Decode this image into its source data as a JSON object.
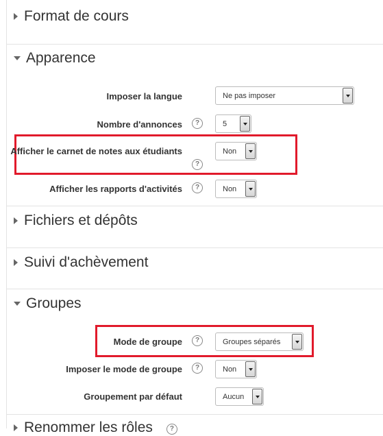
{
  "sections": [
    {
      "title": "Format de cours",
      "expanded": false
    },
    {
      "title": "Apparence",
      "expanded": true
    },
    {
      "title": "Fichiers et dépôts",
      "expanded": false
    },
    {
      "title": "Suivi d'achèvement",
      "expanded": false
    },
    {
      "title": "Groupes",
      "expanded": true
    },
    {
      "title": "Renommer les rôles",
      "expanded": false
    }
  ],
  "apparence": {
    "langue": {
      "label": "Imposer la langue",
      "value": "Ne pas imposer"
    },
    "annonces": {
      "label": "Nombre d'annonces",
      "value": "5"
    },
    "carnet": {
      "label": "Afficher le carnet de notes aux étudiants",
      "value": "Non"
    },
    "rapports": {
      "label": "Afficher les rapports d'activités",
      "value": "Non"
    }
  },
  "groupes": {
    "mode": {
      "label": "Mode de groupe",
      "value": "Groupes séparés"
    },
    "imposer": {
      "label": "Imposer le mode de groupe",
      "value": "Non"
    },
    "groupement": {
      "label": "Groupement par défaut",
      "value": "Aucun"
    }
  },
  "help_glyph": "?",
  "colors": {
    "highlight": "#e11a2b"
  }
}
